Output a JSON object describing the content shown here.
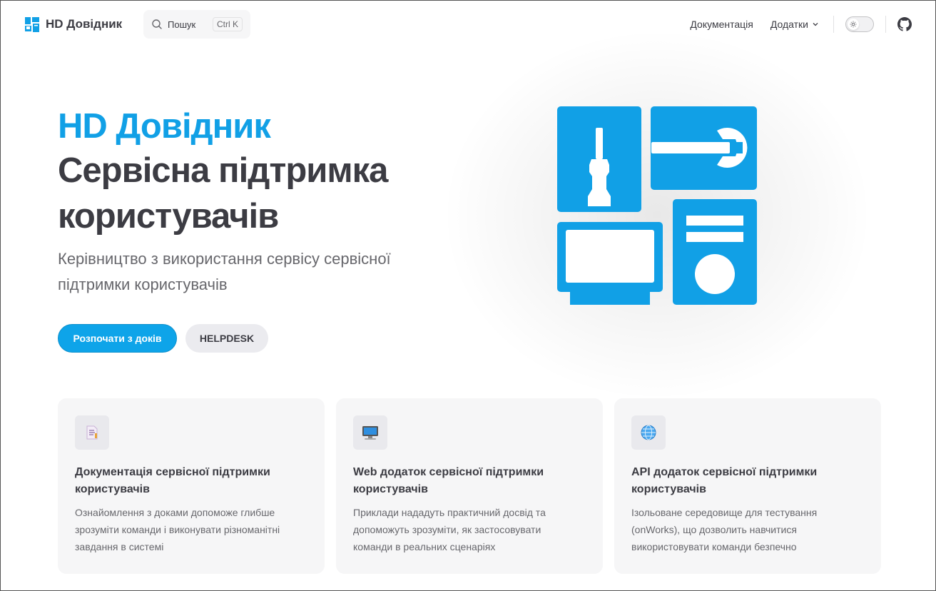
{
  "nav": {
    "brand": "HD Довідник",
    "search_label": "Пошук",
    "search_kbd": "Ctrl K",
    "links": [
      "Документація",
      "Додатки"
    ]
  },
  "hero": {
    "name": "HD Довідник",
    "title_line1": "Сервісна підтримка",
    "title_line2": "користувачів",
    "tagline": "Керівництво з використання сервісу сервісної підтримки користувачів",
    "primary_button": "Розпочати з доків",
    "secondary_button": "HELPDESK"
  },
  "features": [
    {
      "icon": "document-icon",
      "title": "Документація сервісної підтримки користувачів",
      "details": "Ознайомлення з доками допоможе глибше зрозуміти команди і виконувати різноманітні завдання в системі"
    },
    {
      "icon": "computer-icon",
      "title": "Web додаток сервісної підтримки користувачів",
      "details": "Приклади нададуть практичний досвід та допоможуть зрозуміти, як застосовувати команди в реальних сценаріях"
    },
    {
      "icon": "globe-icon",
      "title": "API додаток сервісної підтримки користувачів",
      "details": "Ізольоване середовище для тестування (onWorks), що дозволить навчитися використовувати команди безпечно"
    }
  ],
  "colors": {
    "brand": "#0ea4e9",
    "text": "#3c3c43"
  }
}
